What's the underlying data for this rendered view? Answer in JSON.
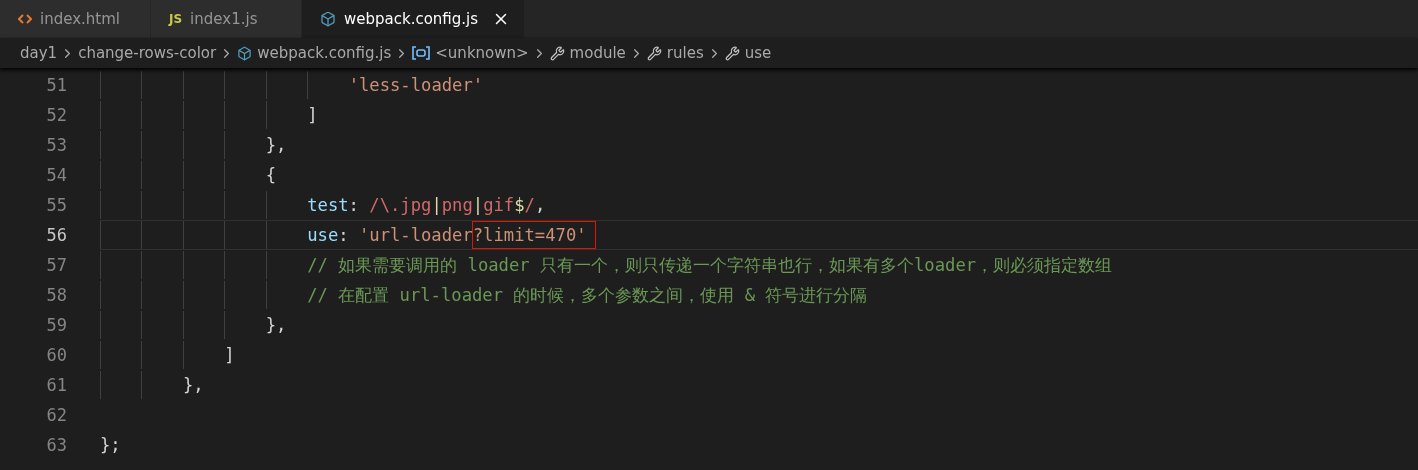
{
  "tabs": [
    {
      "label": "index.html",
      "kind": "html",
      "selected": false,
      "closable": false
    },
    {
      "label": "index1.js",
      "kind": "js",
      "icon_text": "JS",
      "selected": false,
      "closable": false
    },
    {
      "label": "webpack.config.js",
      "kind": "config",
      "selected": true,
      "closable": true
    }
  ],
  "breadcrumbs": [
    {
      "label": "day1",
      "kind": "folder"
    },
    {
      "label": "change-rows-color",
      "kind": "folder"
    },
    {
      "label": "webpack.config.js",
      "kind": "file"
    },
    {
      "label": "<unknown>",
      "kind": "variable"
    },
    {
      "label": "module",
      "kind": "property"
    },
    {
      "label": "rules",
      "kind": "property"
    },
    {
      "label": "use",
      "kind": "property"
    }
  ],
  "lines": [
    {
      "children": [
        {
          "children": [
            {
              "children": [
                {
                  "children": [
                    {
                      "children": [
                        {
                          "children": [
                            {
                              "number": "51",
                              "current": false,
                              "tokens": [
                                {
                                  "kind": "string",
                                  "text": "'less-loader'"
                                }
                              ]
                            }
                          ]
                        },
                        {
                          "number": "52",
                          "current": false,
                          "tokens": [
                            {
                              "kind": "punct",
                              "text": "]"
                            }
                          ]
                        }
                      ]
                    },
                    {
                      "number": "53",
                      "current": false,
                      "tokens": [
                        {
                          "kind": "punct",
                          "text": "},"
                        }
                      ]
                    },
                    {
                      "number": "54",
                      "current": false,
                      "tokens": [
                        {
                          "kind": "punct",
                          "text": "{"
                        }
                      ]
                    },
                    {
                      "children": [
                        {
                          "number": "55",
                          "current": false,
                          "tokens": [
                            {
                              "kind": "key",
                              "text": "test"
                            },
                            {
                              "kind": "punct",
                              "text": ": "
                            },
                            {
                              "kind": "regex",
                              "text": "/\\.jpg"
                            },
                            {
                              "kind": "operator",
                              "text": "|"
                            },
                            {
                              "kind": "regex",
                              "text": "png"
                            },
                            {
                              "kind": "operator",
                              "text": "|"
                            },
                            {
                              "kind": "regex",
                              "text": "gif"
                            },
                            {
                              "kind": "operator",
                              "text": "$"
                            },
                            {
                              "kind": "regex",
                              "text": "/"
                            },
                            {
                              "kind": "punct",
                              "text": ","
                            }
                          ]
                        },
                        {
                          "number": "56",
                          "current": true,
                          "tokens": [
                            {
                              "kind": "key",
                              "text": "use"
                            },
                            {
                              "kind": "punct",
                              "text": ": "
                            },
                            {
                              "kind": "string",
                              "text": "'url-loader",
                              "boxed": false
                            },
                            {
                              "kind": "string",
                              "text": "?limit=470'",
                              "boxed": true
                            }
                          ]
                        },
                        {
                          "number": "57",
                          "current": false,
                          "tokens": [
                            {
                              "kind": "comment",
                              "text": "// 如果需要调用的 loader 只有一个，则只传递一个字符串也行，如果有多个loader，则必须指定数组"
                            }
                          ]
                        },
                        {
                          "number": "58",
                          "current": false,
                          "tokens": [
                            {
                              "kind": "comment",
                              "text": "// 在配置 url-loader 的时候，多个参数之间，使用 & 符号进行分隔"
                            }
                          ]
                        }
                      ]
                    },
                    {
                      "number": "59",
                      "current": false,
                      "tokens": [
                        {
                          "kind": "punct",
                          "text": "},"
                        }
                      ]
                    }
                  ]
                },
                {
                  "number": "60",
                  "current": false,
                  "tokens": [
                    {
                      "kind": "punct",
                      "text": "]"
                    }
                  ]
                }
              ]
            },
            {
              "number": "61",
              "current": false,
              "tokens": [
                {
                  "kind": "punct",
                  "text": "},"
                }
              ]
            }
          ]
        }
      ]
    },
    {
      "number": "62",
      "current": false
    },
    {
      "number": "63",
      "current": false,
      "tokens": [
        {
          "kind": "punct",
          "text": "};"
        }
      ]
    }
  ]
}
